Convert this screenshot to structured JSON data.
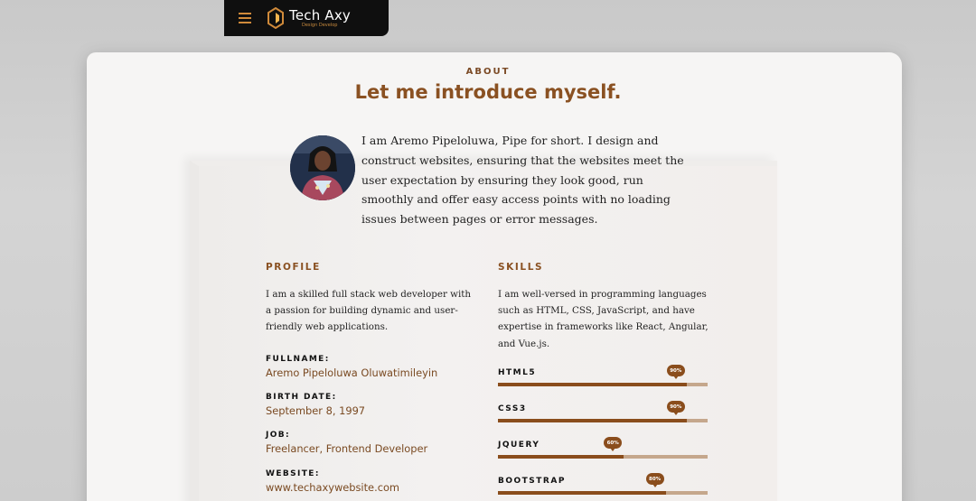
{
  "header": {
    "brand_name": "Tech Axy",
    "brand_tagline": "Design Develop"
  },
  "about": {
    "label": "ABOUT",
    "title": "Let me introduce myself.",
    "intro": "I am Aremo Pipeloluwa, Pipe for short. I design and construct websites, ensuring that the websites meet the user expectation by ensuring they look good, run smoothly and offer easy access points with no loading issues between pages or error messages."
  },
  "profile": {
    "heading": "PROFILE",
    "text": "I am a skilled full stack web developer with a passion for building dynamic and user-friendly web applications.",
    "fields": [
      {
        "label": "FULLNAME:",
        "value": "Aremo Pipeloluwa Oluwatimileyin"
      },
      {
        "label": "BIRTH DATE:",
        "value": "September 8, 1997"
      },
      {
        "label": "JOB:",
        "value": "Freelancer, Frontend Developer"
      },
      {
        "label": "WEBSITE:",
        "value": "www.techaxywebsite.com"
      }
    ]
  },
  "skills": {
    "heading": "SKILLS",
    "text": "I am well-versed in programming languages such as HTML, CSS, JavaScript, and have expertise in frameworks like React, Angular, and Vue.js.",
    "items": [
      {
        "name": "HTML5",
        "percent": 90,
        "badge": "90%"
      },
      {
        "name": "CSS3",
        "percent": 90,
        "badge": "90%"
      },
      {
        "name": "JQUERY",
        "percent": 60,
        "badge": "60%"
      },
      {
        "name": "BOOTSTRAP",
        "percent": 80,
        "badge": "80%"
      }
    ]
  },
  "colors": {
    "accent": "#8a5122",
    "bar_fill": "#8a4d1c",
    "bar_track": "#c5a78c"
  }
}
